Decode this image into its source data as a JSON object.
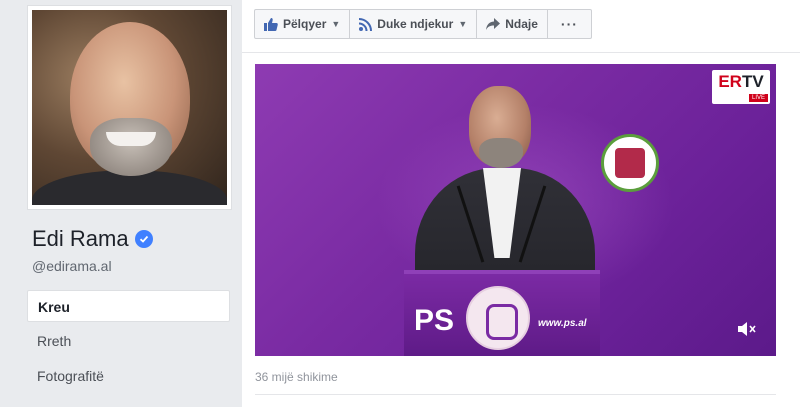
{
  "profile": {
    "name": "Edi Rama",
    "handle": "@edirama.al"
  },
  "nav": {
    "items": [
      {
        "label": "Kreu",
        "active": true
      },
      {
        "label": "Rreth",
        "active": false
      },
      {
        "label": "Fotografitë",
        "active": false
      }
    ]
  },
  "actions": {
    "like_label": "Pëlqyer",
    "follow_label": "Duke ndjekur",
    "share_label": "Ndaje",
    "more_label": "···"
  },
  "video": {
    "channel_logo": {
      "prefix": "ER",
      "suffix": "TV",
      "badge": "LIVE"
    },
    "podium_text": "PS",
    "podium_url": "www.ps.al",
    "views": "36 mijë shikime"
  },
  "colors": {
    "accent": "#4267b2",
    "verified": "#4080ff",
    "video_bg": "#7a2ba3"
  }
}
